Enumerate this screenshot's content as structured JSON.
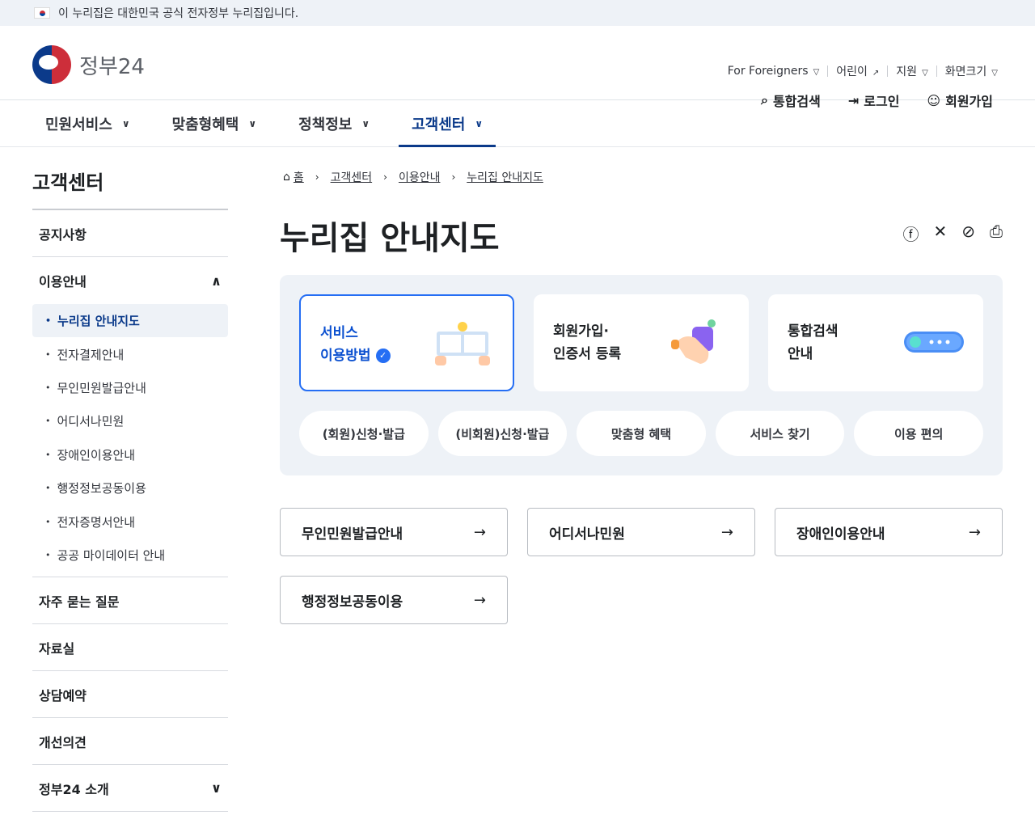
{
  "banner": {
    "text": "이 누리집은 대한민국 공식 전자정부 누리집입니다."
  },
  "logo": {
    "text": "정부24"
  },
  "util": {
    "foreigners": "For Foreigners",
    "kids": "어린이",
    "support": "지원",
    "font": "화면크기"
  },
  "actions": {
    "search": "통합검색",
    "login": "로그인",
    "join": "회원가입"
  },
  "gnb": [
    "민원서비스",
    "맞춤형혜택",
    "정책정보",
    "고객센터"
  ],
  "side": {
    "title": "고객센터",
    "notice": "공지사항",
    "guide": "이용안내",
    "sub": [
      "누리집 안내지도",
      "전자결제안내",
      "무인민원발급안내",
      "어디서나민원",
      "장애인이용안내",
      "행정정보공동이용",
      "전자증명서안내",
      "공공 마이데이터 안내"
    ],
    "faq": "자주 묻는 질문",
    "data": "자료실",
    "consult": "상담예약",
    "improve": "개선의견",
    "about": "정부24 소개"
  },
  "breadcrumb": [
    "홈",
    "고객센터",
    "이용안내",
    "누리집 안내지도"
  ],
  "page_title": "누리집 안내지도",
  "cards": [
    {
      "line1": "서비스",
      "line2": "이용방법"
    },
    {
      "line1": "회원가입·",
      "line2": "인증서 등록"
    },
    {
      "line1": "통합검색",
      "line2": "안내"
    }
  ],
  "pills": [
    "(회원)신청·발급",
    "(비회원)신청·발급",
    "맞춤형 혜택",
    "서비스 찾기",
    "이용 편의"
  ],
  "links": [
    "무인민원발급안내",
    "어디서나민원",
    "장애인이용안내",
    "행정정보공동이용"
  ]
}
